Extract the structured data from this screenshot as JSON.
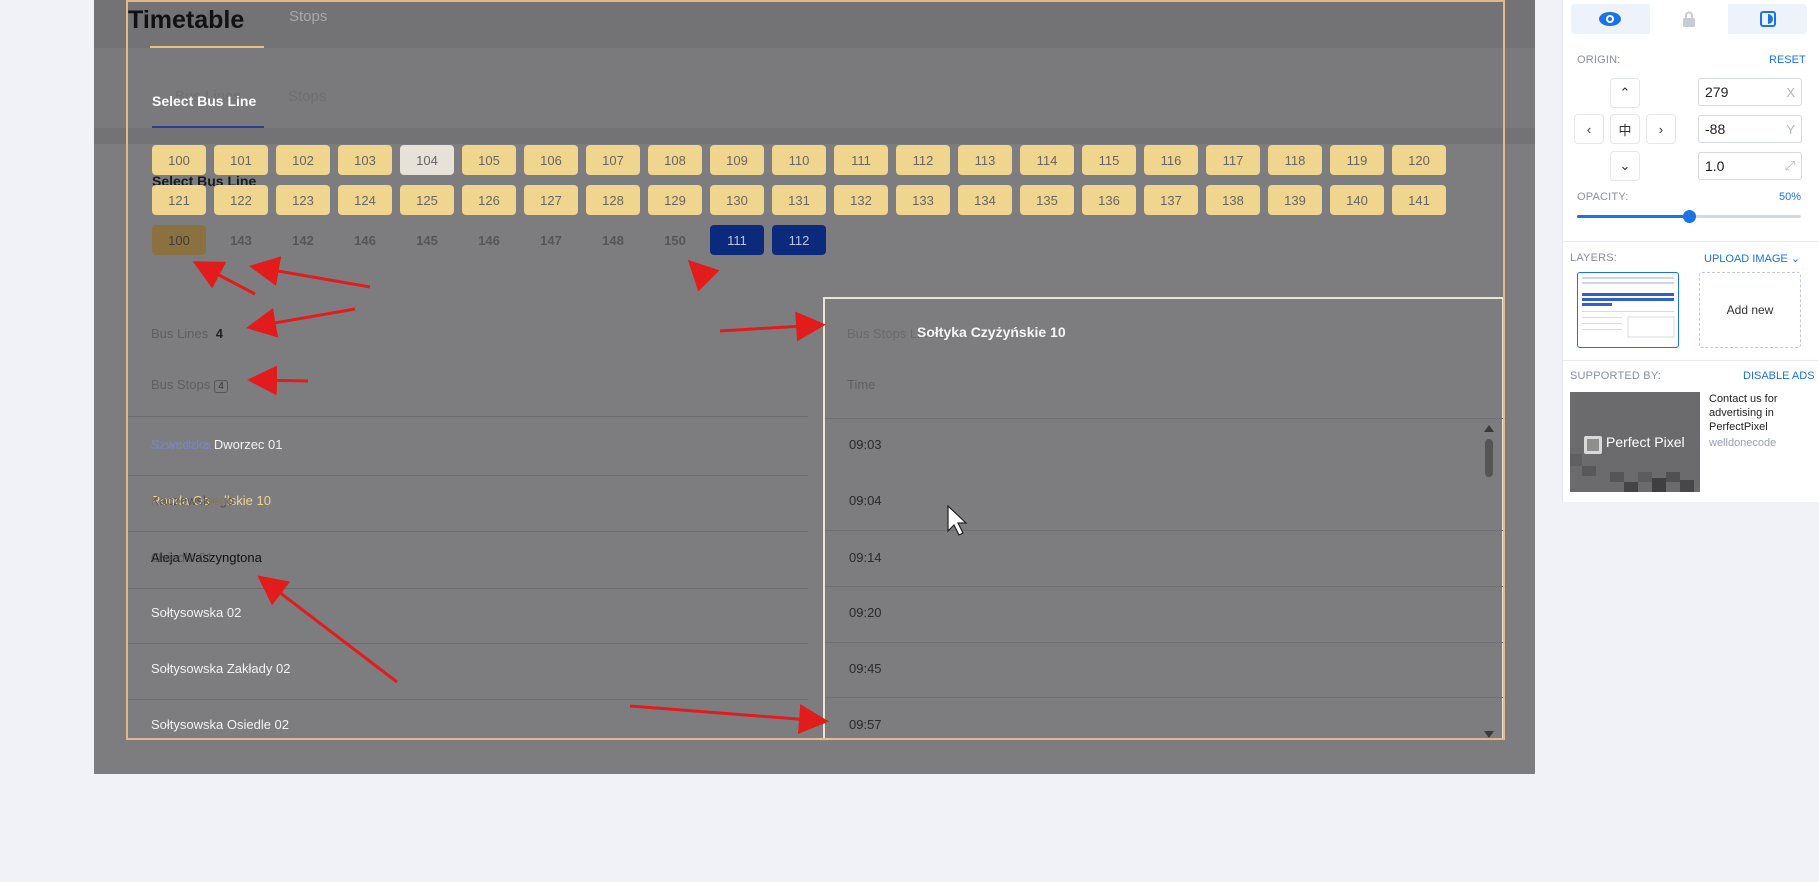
{
  "app": {
    "page_title": "Timetable",
    "ghost_tabs": [
      "Bus Lines",
      "Stops"
    ],
    "tabs": [
      "Bus Lines",
      "Stops"
    ],
    "select_bus_line_label": "Select Bus Line",
    "bus_lines_row1": [
      "100",
      "101",
      "102",
      "103",
      "104",
      "105",
      "106",
      "107",
      "108",
      "109",
      "110",
      "111",
      "112",
      "113",
      "114",
      "115",
      "116",
      "117",
      "118",
      "119",
      "120"
    ],
    "bus_lines_row2": [
      "121",
      "122",
      "123",
      "124",
      "125",
      "126",
      "127",
      "128",
      "129",
      "130",
      "131",
      "132",
      "133",
      "134",
      "135",
      "136",
      "137",
      "138",
      "139",
      "140",
      "141"
    ],
    "bus_lines_row3": [
      "100",
      "143",
      "142",
      "146",
      "145",
      "146",
      "147",
      "148",
      "150",
      "111",
      "112"
    ],
    "selected_line": "104",
    "bus_lines_count_label": "Bus Lines",
    "bus_lines_count": "4",
    "bus_stops_label": "Bus Stops",
    "bus_stops_count": "4",
    "stops": [
      "Szwedzka Dworzec 01",
      "Ronda Osiedlskie 10",
      "Aleja Waszyngtona",
      "Sołtysowska 02",
      "Sołtysowska Zakłady 02",
      "Sołtysowska Osiedle 02"
    ],
    "ghost_stops": [
      "Szwedzka",
      "Kaczewskiego",
      "Osiedle 01"
    ],
    "detail_title": "Sołtyka Czyżyńskie 10",
    "detail_ghost_title": "Bus Stops Line 104",
    "time_header": "Time",
    "times": [
      "09:03",
      "09:04",
      "09:14",
      "09:20",
      "09:45",
      "09:57"
    ]
  },
  "panel": {
    "origin_label": "ORIGIN:",
    "reset_label": "RESET",
    "x_value": "279",
    "x_unit": "X",
    "y_value": "-88",
    "y_unit": "Y",
    "scale_value": "1.0",
    "scale_unit": "⤢",
    "opacity_label": "OPACITY:",
    "opacity_value": "50%",
    "opacity": 0.5,
    "layers_label": "LAYERS:",
    "upload_label": "UPLOAD IMAGE",
    "add_new_label": "Add new",
    "supported_label": "SUPPORTED BY:",
    "disable_ads_label": "DISABLE ADS",
    "ad_brand": "Perfect Pixel",
    "ad_text": "Contact us for advertising in PerfectPixel",
    "ad_sub": "welldonecode",
    "accent_color": "#1a73e8"
  }
}
